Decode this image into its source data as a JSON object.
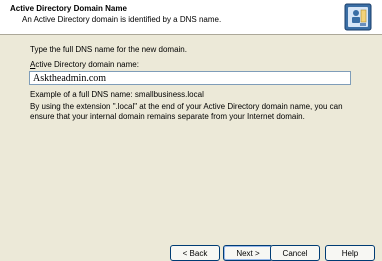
{
  "header": {
    "title": "Active Directory Domain Name",
    "subtitle": "An Active Directory domain is identified by a DNS name."
  },
  "content": {
    "instruction": "Type the full DNS name for the new domain.",
    "field_label_accel": "A",
    "field_label_rest": "ctive Directory domain name:",
    "domain_value": "Asktheadmin.com",
    "example": "Example of a full DNS name: smallbusiness.local",
    "note": "By using the extension \".local\" at the end of your Active Directory domain name, you can ensure that your internal domain remains separate from your Internet domain."
  },
  "buttons": {
    "back": "< Back",
    "next": "Next >",
    "cancel": "Cancel",
    "help": "Help"
  },
  "icons": {
    "header_icon": "wizard-directory-icon"
  }
}
